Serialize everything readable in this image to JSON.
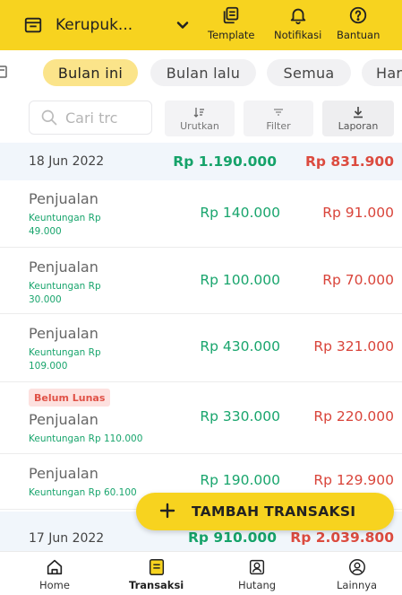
{
  "header": {
    "shop_name": "Kerupuk...",
    "actions": [
      {
        "label": "Template",
        "icon": "template-icon"
      },
      {
        "label": "Notifikasi",
        "icon": "bell-icon"
      },
      {
        "label": "Bantuan",
        "icon": "help-icon"
      }
    ]
  },
  "filters": {
    "chips": [
      "Bulan ini",
      "Bulan lalu",
      "Semua",
      "Har"
    ],
    "active": "Bulan ini"
  },
  "toolbar": {
    "search_placeholder": "Cari trc",
    "sort_label": "Urutkan",
    "filter_label": "Filter",
    "report_label": "Laporan"
  },
  "groups": [
    {
      "date": "18 Jun 2022",
      "total_in": "Rp 1.190.000",
      "total_out": "Rp 831.900",
      "transactions": [
        {
          "title": "Penjualan",
          "profit_line1": "Keuntungan Rp",
          "profit_line2": "49.000",
          "amount_in": "Rp 140.000",
          "amount_out": "Rp 91.000"
        },
        {
          "title": "Penjualan",
          "profit_line1": "Keuntungan Rp",
          "profit_line2": "30.000",
          "amount_in": "Rp 100.000",
          "amount_out": "Rp 70.000"
        },
        {
          "title": "Penjualan",
          "profit_line1": "Keuntungan Rp",
          "profit_line2": "109.000",
          "amount_in": "Rp 430.000",
          "amount_out": "Rp 321.000"
        },
        {
          "badge": "Belum Lunas",
          "title": "Penjualan",
          "profit_line1": "Keuntungan Rp 110.000",
          "amount_in": "Rp 330.000",
          "amount_out": "Rp 220.000"
        },
        {
          "title": "Penjualan",
          "profit_line1": "Keuntungan Rp 60.100",
          "amount_in": "Rp 190.000",
          "amount_out": "Rp 129.900"
        }
      ]
    },
    {
      "date": "17 Jun 2022",
      "total_in": "Rp 910.000",
      "total_out": "Rp 2.039.800"
    }
  ],
  "fab": {
    "label": "TAMBAH TRANSAKSI"
  },
  "nav": {
    "items": [
      {
        "label": "Home",
        "icon": "home-icon"
      },
      {
        "label": "Transaksi",
        "icon": "transaction-icon"
      },
      {
        "label": "Hutang",
        "icon": "debt-icon"
      },
      {
        "label": "Lainnya",
        "icon": "more-icon"
      }
    ],
    "active": "Transaksi"
  },
  "colors": {
    "brand_yellow": "#f7d31f",
    "chip_active": "#fbe48a",
    "income_green": "#19a56d",
    "expense_red": "#d9443a",
    "date_row_bg": "#f1f6fb"
  }
}
